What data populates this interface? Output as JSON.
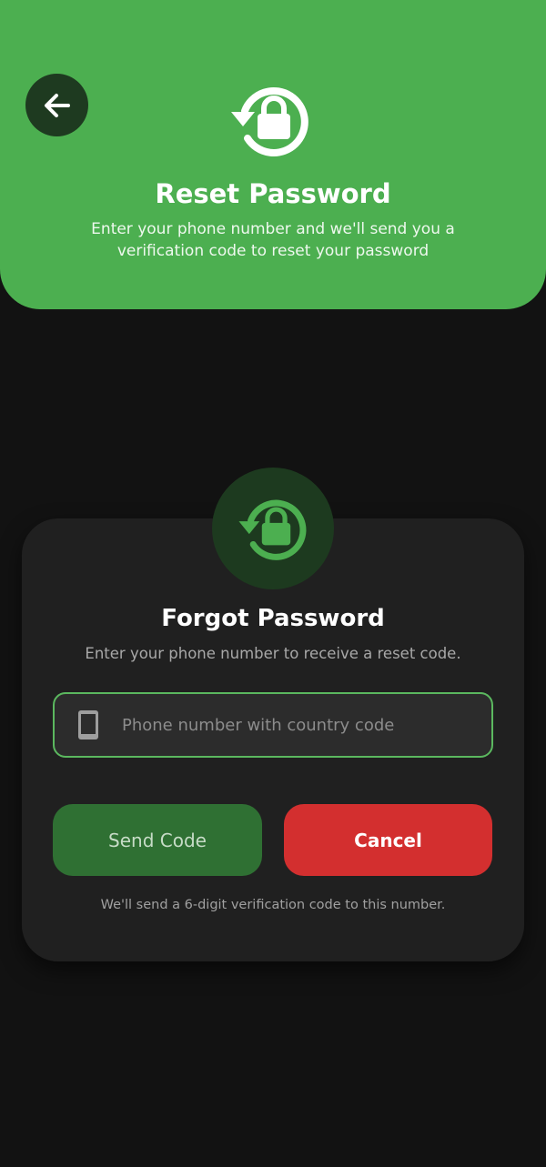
{
  "header": {
    "back_icon": "arrow-left-icon",
    "reset_icon": "lock-reset-icon",
    "title": "Reset Password",
    "subtitle": "Enter your phone number and we'll send you a verification code to reset your password"
  },
  "card": {
    "icon": "lock-reset-icon",
    "title": "Forgot Password",
    "subtitle": "Enter your phone number to receive a reset code.",
    "phone_field": {
      "icon": "phone-icon",
      "value": "",
      "placeholder": "Phone number with country code"
    },
    "send_label": "Send Code",
    "cancel_label": "Cancel",
    "note": "We'll send a 6-digit verification code to this number."
  },
  "colors": {
    "accent": "#4caf50",
    "background": "#121212",
    "card": "#202020",
    "send_button": "#2f7033",
    "cancel_button": "#d32f2f"
  }
}
